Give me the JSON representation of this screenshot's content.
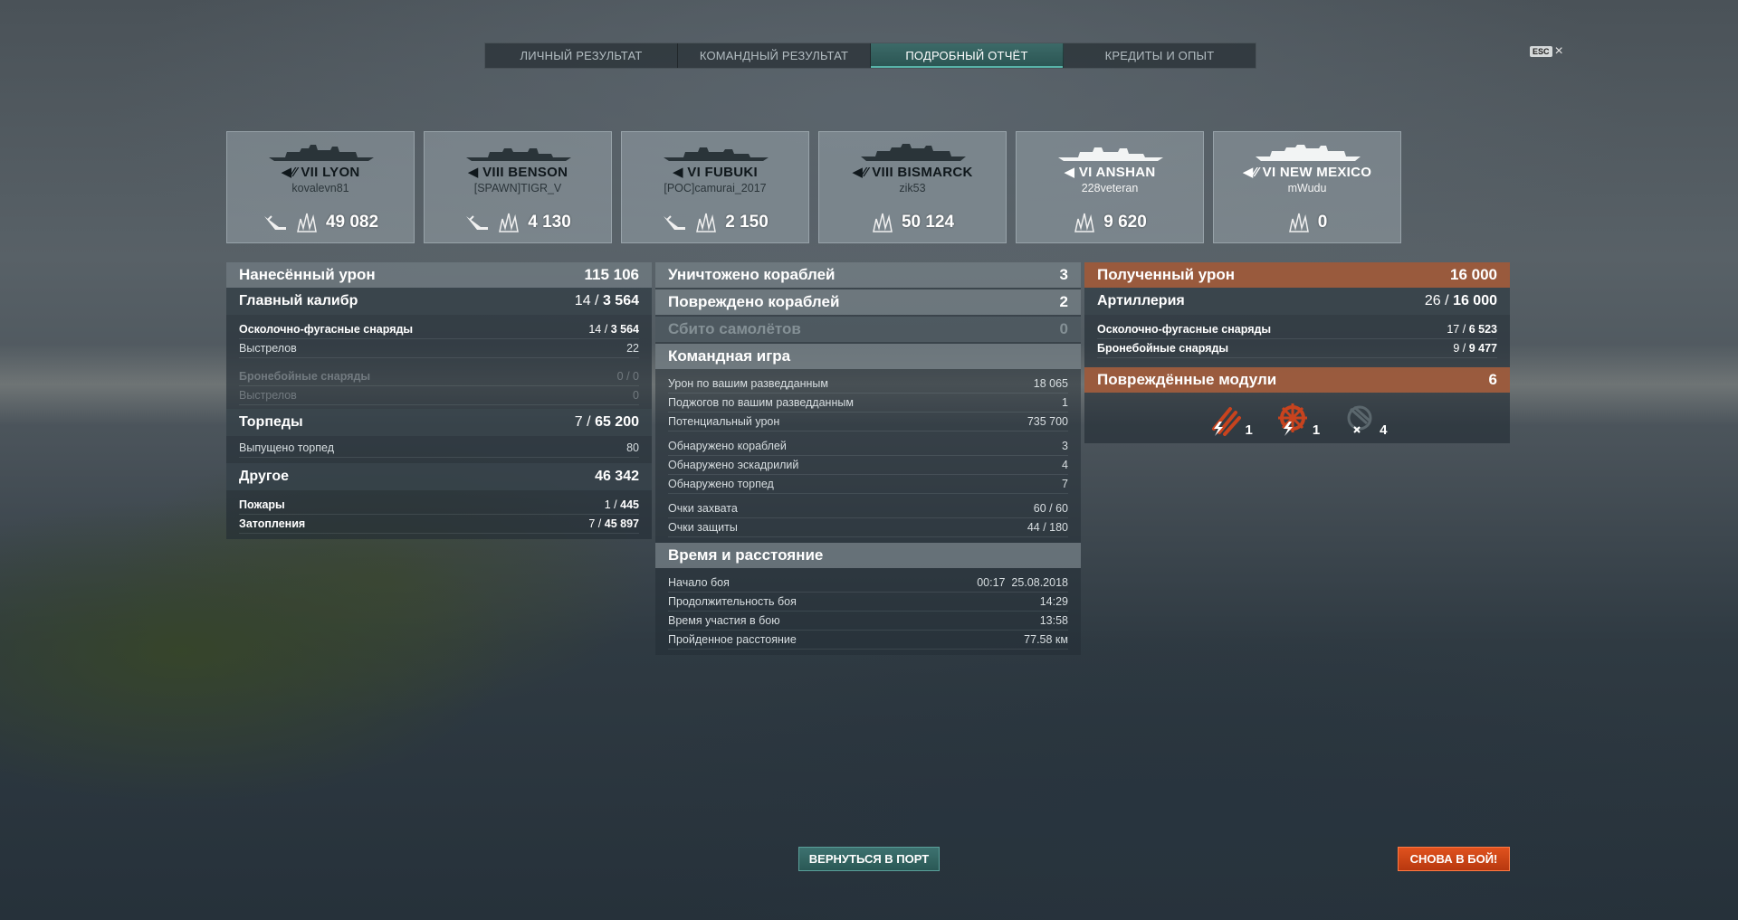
{
  "tabs": [
    {
      "label": "ЛИЧНЫЙ РЕЗУЛЬТАТ",
      "active": false
    },
    {
      "label": "КОМАНДНЫЙ РЕЗУЛЬТАТ",
      "active": false
    },
    {
      "label": "ПОДРОБНЫЙ ОТЧЁТ",
      "active": true
    },
    {
      "label": "КРЕДИТЫ И ОПЫТ",
      "active": false
    }
  ],
  "esc": {
    "key": "ESC",
    "close": "×"
  },
  "ships": [
    {
      "name": "VII LYON",
      "player": "kovalevn81",
      "torpedo_hits_icon": true,
      "damage": "49 082"
    },
    {
      "name": "VIII BENSON",
      "player": "[SPAWN]TIGR_V",
      "torpedo_hits_icon": true,
      "damage": "4 130"
    },
    {
      "name": "VI FUBUKI",
      "player": "[POC]camurai_2017",
      "torpedo_hits_icon": true,
      "damage": "2 150"
    },
    {
      "name": "VIII BISMARCK",
      "player": "zik53",
      "torpedo_hits_icon": false,
      "damage": "50 124"
    },
    {
      "name": "VI ANSHAN",
      "player": "228veteran",
      "torpedo_hits_icon": false,
      "damage": "9 620"
    },
    {
      "name": "VI NEW MEXICO",
      "player": "mWudu",
      "torpedo_hits_icon": false,
      "damage": "0"
    }
  ],
  "damage_dealt": {
    "title": "Нанесённый урон",
    "total": "115 106",
    "main_battery": {
      "label": "Главный калибр",
      "hits": "14",
      "sep": "/",
      "value": "3 564"
    },
    "he": {
      "label": "Осколочно-фугасные снаряды",
      "hits": "14",
      "sep": "/",
      "value": "3 564"
    },
    "he_shots": {
      "label": "Выстрелов",
      "value": "22"
    },
    "ap": {
      "label": "Бронебойные снаряды",
      "value": "0 / 0"
    },
    "ap_shots": {
      "label": "Выстрелов",
      "value": "0"
    },
    "torpedoes": {
      "label": "Торпеды",
      "hits": "7",
      "sep": "/",
      "value": "65 200"
    },
    "torp_launched": {
      "label": "Выпущено торпед",
      "value": "80"
    },
    "other": {
      "label": "Другое",
      "value": "46 342"
    },
    "fires": {
      "label": "Пожары",
      "hits": "1",
      "sep": "/",
      "value": "445"
    },
    "floods": {
      "label": "Затопления",
      "hits": "7",
      "sep": "/",
      "value": "45 897"
    }
  },
  "middle": {
    "destroyed": {
      "label": "Уничтожено кораблей",
      "value": "3"
    },
    "damaged": {
      "label": "Повреждено кораблей",
      "value": "2"
    },
    "planes": {
      "label": "Сбито самолётов",
      "value": "0"
    },
    "team": {
      "title": "Командная игра",
      "spotting_damage": {
        "label": "Урон по вашим разведданным",
        "value": "18 065"
      },
      "spotting_fires": {
        "label": "Поджогов по вашим разведданным",
        "value": "1"
      },
      "potential": {
        "label": "Потенциальный урон",
        "value": "735 700"
      },
      "ships_spotted": {
        "label": "Обнаружено кораблей",
        "value": "3"
      },
      "squadrons_spotted": {
        "label": "Обнаружено эскадрилий",
        "value": "4"
      },
      "torps_spotted": {
        "label": "Обнаружено торпед",
        "value": "7"
      },
      "capture": {
        "label": "Очки захвата",
        "value": "60 / 60"
      },
      "defense": {
        "label": "Очки защиты",
        "value": "44 / 180"
      }
    },
    "time": {
      "title": "Время и расстояние",
      "start": {
        "label": "Начало боя",
        "value": "00:17  25.08.2018"
      },
      "duration": {
        "label": "Продолжительность боя",
        "value": "14:29"
      },
      "participation": {
        "label": "Время участия в бою",
        "value": "13:58"
      },
      "distance": {
        "label": "Пройденное расстояние",
        "value": "77.58 км"
      }
    }
  },
  "damage_received": {
    "title": "Полученный урон",
    "total": "16 000",
    "artillery": {
      "label": "Артиллерия",
      "hits": "26",
      "sep": "/",
      "value": "16 000"
    },
    "he": {
      "label": "Осколочно-фугасные снаряды",
      "hits": "17",
      "sep": "/",
      "value": "6 523"
    },
    "ap": {
      "label": "Бронебойные снаряды",
      "hits": "9",
      "sep": "/",
      "value": "9 477"
    },
    "modules": {
      "title": "Повреждённые модули",
      "value": "6",
      "items": [
        {
          "icon": "torpedo-tubes-damaged-icon",
          "count": "1"
        },
        {
          "icon": "steering-damaged-icon",
          "count": "1"
        },
        {
          "icon": "aa-destroyed-icon",
          "count": "4"
        }
      ]
    }
  },
  "buttons": {
    "port": "ВЕРНУТЬСЯ В ПОРТ",
    "battle": "СНОВА В БОЙ!"
  },
  "colors": {
    "accent_teal": "#2a5452",
    "orange": "#aa5f3c",
    "battle_red": "#d44a18"
  }
}
